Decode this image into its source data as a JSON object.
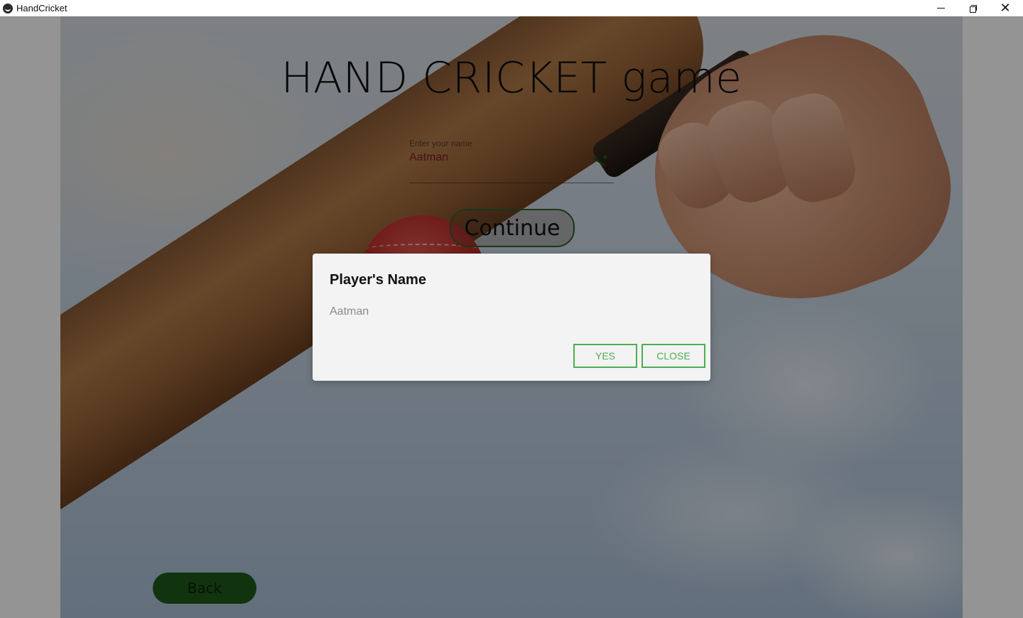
{
  "window": {
    "title": "HandCricket",
    "icon": "kivy-app-icon",
    "controls": [
      "minimize-icon",
      "restore-icon",
      "close-icon"
    ]
  },
  "page": {
    "title": "HAND CRICKET game",
    "name_field": {
      "label": "Enter your name",
      "value": "Aatman",
      "icon": "cricket-bat-ball-icon"
    },
    "continue_label": "Continue",
    "back_label": "Back"
  },
  "dialog": {
    "title": "Player's Name",
    "body": "Aatman",
    "yes_label": "YES",
    "close_label": "CLOSE"
  },
  "colors": {
    "dialog_button_accent": "#4caf50",
    "back_button": "#1e5a1a",
    "dialog_background": "#f3f3f3"
  }
}
